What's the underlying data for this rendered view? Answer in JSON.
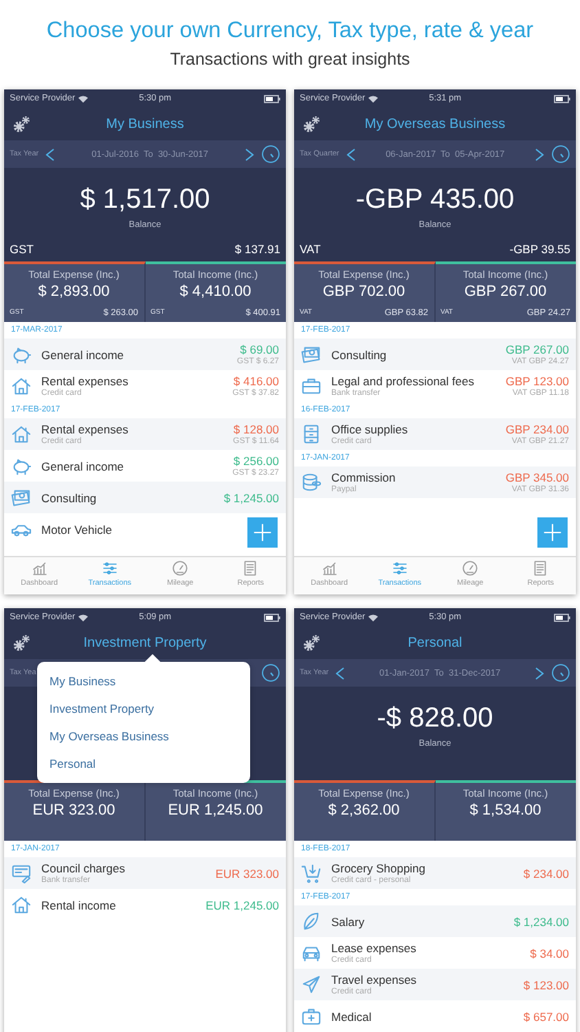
{
  "headline": "Choose your own Currency, Tax type, rate & year",
  "subheadline": "Transactions with great insights",
  "phones": [
    {
      "status": {
        "provider": "Service Provider",
        "time": "5:30 pm"
      },
      "title": "My Business",
      "period": {
        "label": "Tax Year",
        "range": "01-Jul-2016  To  30-Jun-2017"
      },
      "balance": {
        "amount": "$ 1,517.00",
        "label": "Balance",
        "tax_label": "GST",
        "tax_value": "$ 137.91"
      },
      "totals": [
        {
          "kind": "expense",
          "title": "Total Expense (Inc.)",
          "amount": "$ 2,893.00",
          "tax_label": "GST",
          "tax_value": "$ 263.00"
        },
        {
          "kind": "income",
          "title": "Total Income (Inc.)",
          "amount": "$ 4,410.00",
          "tax_label": "GST",
          "tax_value": "$ 400.91"
        }
      ],
      "sections": [
        {
          "date": "17-MAR-2017",
          "items": [
            {
              "kind": "piggy-bank",
              "color": "#3dbb8c",
              "name": "General income",
              "amount": "$ 69.00",
              "tax": "GST $ 6.27"
            },
            {
              "kind": "house",
              "color": "#ee6a4d",
              "name": "Rental expenses",
              "sub": "Credit card",
              "amount": "$ 416.00",
              "tax": "GST $ 37.82"
            }
          ]
        },
        {
          "date": "17-FEB-2017",
          "items": [
            {
              "kind": "house",
              "color": "#ee6a4d",
              "name": "Rental expenses",
              "sub": "Credit card",
              "amount": "$ 128.00",
              "tax": "GST $ 11.64"
            },
            {
              "kind": "piggy-bank",
              "color": "#3dbb8c",
              "name": "General income",
              "amount": "$ 256.00",
              "tax": "GST $ 23.27"
            },
            {
              "kind": "banknotes",
              "color": "#3dbb8c",
              "name": "Consulting",
              "amount": "$ 1,245.00"
            },
            {
              "kind": "car",
              "name": "Motor Vehicle"
            }
          ]
        }
      ],
      "add_button": true,
      "tabs": [
        {
          "kind": "chart",
          "label": "Dashboard",
          "selected": false
        },
        {
          "kind": "sliders",
          "label": "Transactions",
          "selected": true
        },
        {
          "kind": "gauge",
          "label": "Mileage",
          "selected": false
        },
        {
          "kind": "document",
          "label": "Reports",
          "selected": false
        }
      ]
    },
    {
      "status": {
        "provider": "Service Provider",
        "time": "5:31 pm"
      },
      "title": "My Overseas Business",
      "period": {
        "label": "Tax Quarter",
        "range": "06-Jan-2017  To  05-Apr-2017"
      },
      "balance": {
        "amount": "-GBP 435.00",
        "label": "Balance",
        "tax_label": "VAT",
        "tax_value": "-GBP 39.55"
      },
      "totals": [
        {
          "kind": "expense",
          "title": "Total Expense (Inc.)",
          "amount": "GBP 702.00",
          "tax_label": "VAT",
          "tax_value": "GBP 63.82"
        },
        {
          "kind": "income",
          "title": "Total Income (Inc.)",
          "amount": "GBP 267.00",
          "tax_label": "VAT",
          "tax_value": "GBP 24.27"
        }
      ],
      "sections": [
        {
          "date": "17-FEB-2017",
          "items": [
            {
              "kind": "banknotes",
              "color": "#3dbb8c",
              "name": "Consulting",
              "amount": "GBP 267.00",
              "tax": "VAT GBP 24.27"
            },
            {
              "kind": "briefcase",
              "color": "#ee6a4d",
              "name": "Legal and professional fees",
              "sub": "Bank transfer",
              "amount": "GBP 123.00",
              "tax": "VAT GBP 11.18"
            }
          ]
        },
        {
          "date": "16-FEB-2017",
          "items": [
            {
              "kind": "cabinet",
              "color": "#ee6a4d",
              "name": "Office supplies",
              "sub": "Credit card",
              "amount": "GBP 234.00",
              "tax": "VAT GBP 21.27"
            }
          ]
        },
        {
          "date": "17-JAN-2017",
          "items": [
            {
              "kind": "coins",
              "color": "#ee6a4d",
              "name": "Commission",
              "sub": "Paypal",
              "amount": "GBP 345.00",
              "tax": "VAT GBP 31.36"
            }
          ]
        }
      ],
      "add_button": true,
      "tabs": [
        {
          "kind": "chart",
          "label": "Dashboard",
          "selected": false
        },
        {
          "kind": "sliders",
          "label": "Transactions",
          "selected": true
        },
        {
          "kind": "gauge",
          "label": "Mileage",
          "selected": false
        },
        {
          "kind": "document",
          "label": "Reports",
          "selected": false
        }
      ]
    },
    {
      "status": {
        "provider": "Service Provider",
        "time": "5:09 pm"
      },
      "title": "Investment Property",
      "period": {
        "label": "Tax Yea"
      },
      "menu": [
        "My Business",
        "Investment Property",
        "My Overseas Business",
        "Personal"
      ],
      "totals": [
        {
          "kind": "expense",
          "title": "Total Expense (Inc.)",
          "amount": "EUR 323.00"
        },
        {
          "kind": "income",
          "title": "Total Income (Inc.)",
          "amount": "EUR 1,245.00"
        }
      ],
      "sections": [
        {
          "date": "17-JAN-2017",
          "items": [
            {
              "kind": "bill",
              "color": "#ee6a4d",
              "name": "Council charges",
              "sub": "Bank transfer",
              "amount": "EUR 323.00"
            },
            {
              "kind": "house",
              "color": "#3dbb8c",
              "name": "Rental income",
              "amount": "EUR 1,245.00"
            }
          ]
        }
      ],
      "add_button": false
    },
    {
      "status": {
        "provider": "Service Provider",
        "time": "5:30 pm"
      },
      "title": "Personal",
      "period": {
        "label": "Tax Year",
        "range": "01-Jan-2017  To  31-Dec-2017"
      },
      "balance": {
        "amount": "-$ 828.00",
        "label": "Balance"
      },
      "totals": [
        {
          "kind": "expense",
          "title": "Total Expense (Inc.)",
          "amount": "$ 2,362.00"
        },
        {
          "kind": "income",
          "title": "Total Income (Inc.)",
          "amount": "$ 1,534.00"
        }
      ],
      "sections": [
        {
          "date": "18-FEB-2017",
          "items": [
            {
              "kind": "cart",
              "color": "#ee6a4d",
              "name": "Grocery Shopping",
              "sub": "Credit card - personal",
              "amount": "$ 234.00"
            }
          ]
        },
        {
          "date": "17-FEB-2017",
          "items": [
            {
              "kind": "leaf",
              "color": "#3dbb8c",
              "name": "Salary",
              "amount": "$ 1,234.00"
            },
            {
              "kind": "car-front",
              "color": "#ee6a4d",
              "name": "Lease expenses",
              "sub": "Credit card",
              "amount": "$ 34.00"
            },
            {
              "kind": "plane",
              "color": "#ee6a4d",
              "name": "Travel expenses",
              "sub": "Credit card",
              "amount": "$ 123.00"
            },
            {
              "kind": "medkit",
              "color": "#ee6a4d",
              "name": "Medical",
              "amount": "$ 657.00"
            }
          ]
        }
      ],
      "add_button": false
    }
  ]
}
